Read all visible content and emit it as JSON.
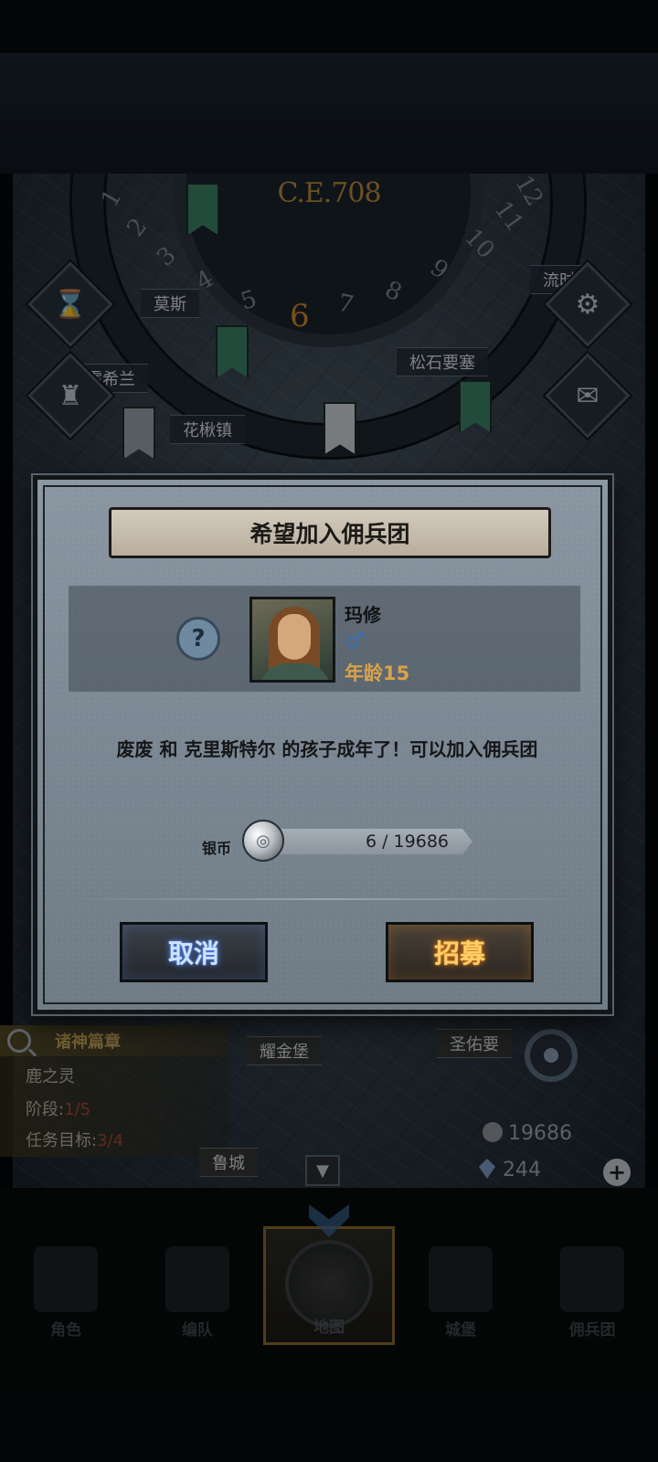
{
  "map": {
    "year": "C.E.708",
    "dial_numbers": [
      "1",
      "2",
      "3",
      "4",
      "5",
      "7",
      "8",
      "9",
      "10",
      "11",
      "12"
    ],
    "dial_active": "6",
    "labels": {
      "moss": "莫斯",
      "flow": "流时",
      "heath": "霍希兰",
      "pine_fortress": "松石要塞",
      "flower": "花楸镇",
      "gold": "耀金堡",
      "holy": "圣佑要",
      "city": "鲁城"
    }
  },
  "dialog": {
    "title": "希望加入佣兵团",
    "character": {
      "name": "玛修",
      "gender_symbol": "♂",
      "age_label": "年龄15"
    },
    "help_symbol": "?",
    "message": "废废 和 克里斯特尔 的孩子成年了！可以加入佣兵团",
    "cost": {
      "label": "银币",
      "value": "6 / 19686"
    },
    "buttons": {
      "cancel": "取消",
      "recruit": "招募"
    }
  },
  "quest": {
    "title": "诸神篇章",
    "name": "鹿之灵",
    "stage_label": "阶段:",
    "stage_value": "1/5",
    "goal_label": "任务目标:",
    "goal_value": "3/4"
  },
  "resources": {
    "silver": "19686",
    "gems": "244",
    "plus": "+"
  },
  "collapse_symbol": "▼",
  "nav": {
    "role": "角色",
    "team": "编队",
    "map": "地图",
    "castle": "城堡",
    "mercenary": "佣兵团"
  },
  "colors": {
    "cancel_glow": "#4d86ff",
    "recruit_glow": "#e07b12",
    "age_color": "#d9a24a",
    "banner_bg": "#c8beaf"
  }
}
